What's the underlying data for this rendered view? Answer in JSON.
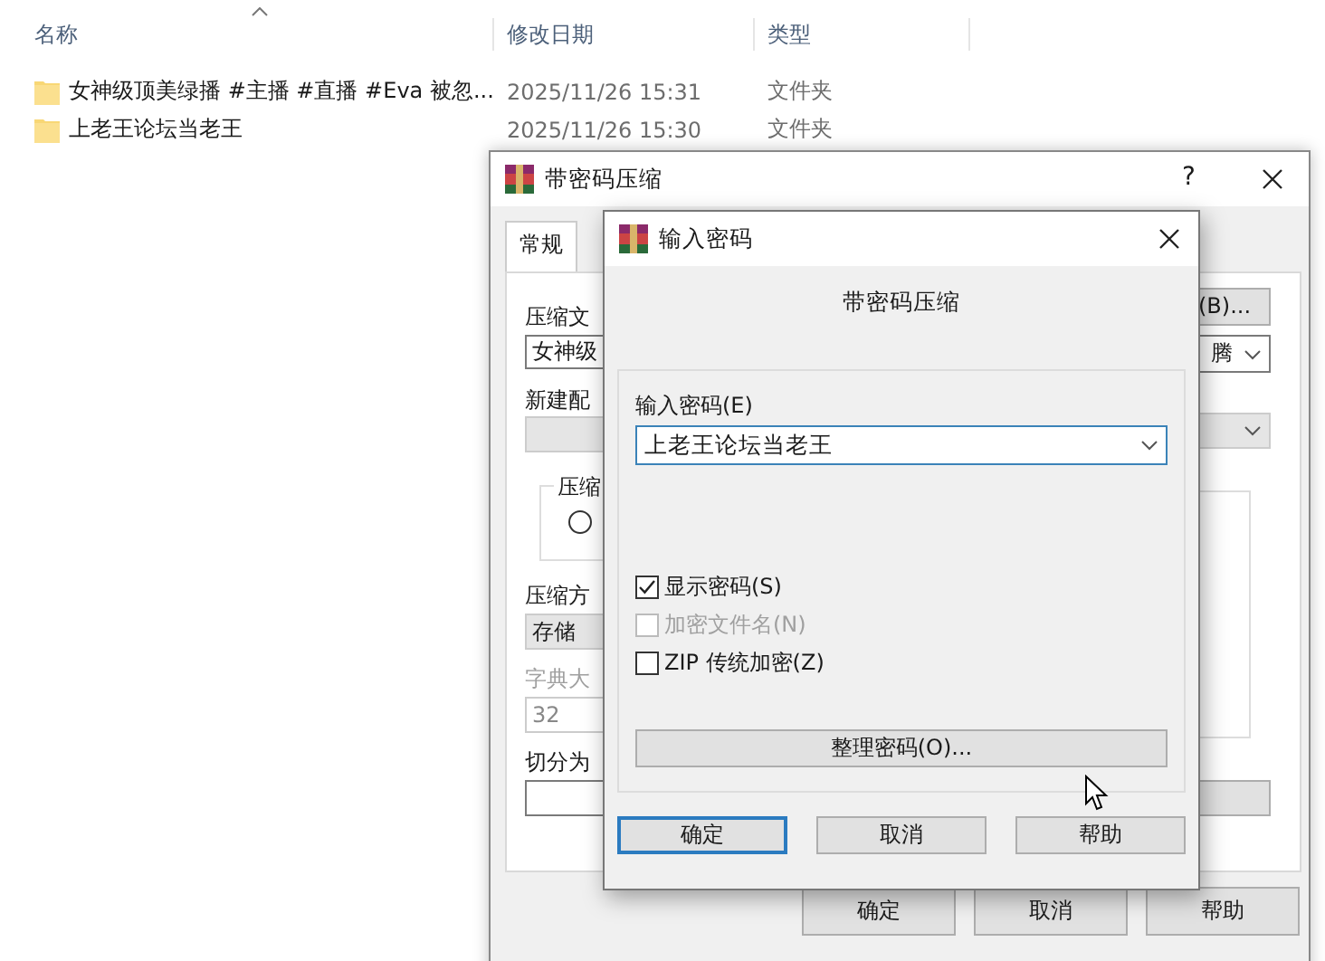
{
  "explorer": {
    "columns": [
      "名称",
      "修改日期",
      "类型"
    ],
    "rows": [
      {
        "name": "女神级顶美绿播 #主播 #直播 #Eva 被忽...",
        "modified": "2025/11/26 15:31",
        "type": "文件夹"
      },
      {
        "name": "上老王论坛当老王",
        "modified": "2025/11/26 15:30",
        "type": "文件夹"
      }
    ]
  },
  "compress_dialog": {
    "title": "带密码压缩",
    "help_button": "?",
    "tabs": [
      {
        "label": "常规",
        "selected": true
      }
    ],
    "archive_label": "压缩文",
    "archive_value": "女神级",
    "browse_button": "(B)...",
    "update_value": "腾",
    "profile_label": "新建配",
    "group_label": "压缩",
    "radio": {
      "selected": false
    },
    "method_label": "压缩方",
    "method_value": "存储",
    "dictionary_label": "字典大",
    "dictionary_value": "32",
    "split_label": "切分为",
    "buttons": [
      "确定",
      "取消",
      "帮助"
    ]
  },
  "password_dialog": {
    "title": "输入密码",
    "heading": "带密码压缩",
    "password_label": "输入密码(E)",
    "password_value": "上老王论坛当老王",
    "options": [
      {
        "label": "显示密码(S)",
        "checked": true,
        "disabled": false
      },
      {
        "label": "加密文件名(N)",
        "checked": false,
        "disabled": true
      },
      {
        "label": "ZIP 传统加密(Z)",
        "checked": false,
        "disabled": false
      }
    ],
    "organize_button": "整理密码(O)...",
    "buttons": [
      {
        "label": "确定",
        "focused": true
      },
      {
        "label": "取消",
        "focused": false
      },
      {
        "label": "帮助",
        "focused": false
      }
    ]
  }
}
